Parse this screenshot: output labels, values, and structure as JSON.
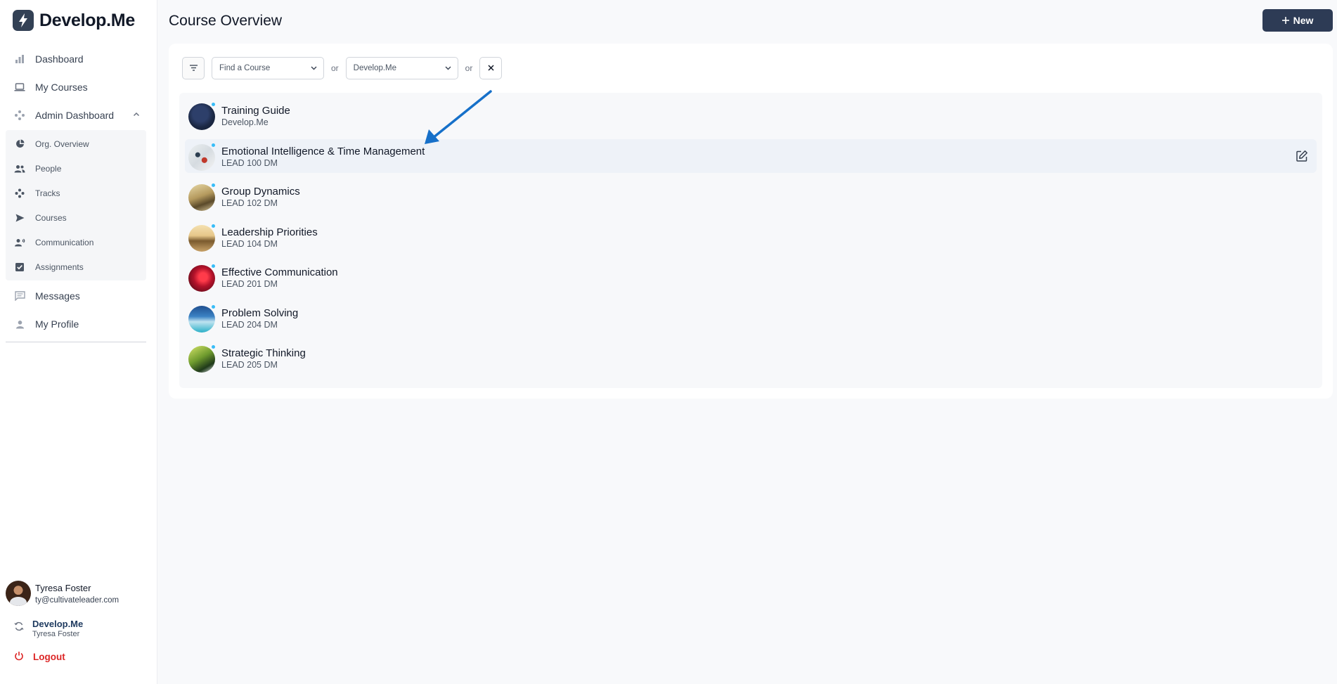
{
  "brand": {
    "name": "Develop.Me"
  },
  "sidebar": {
    "nav": [
      {
        "label": "Dashboard",
        "icon": "bar-chart-icon"
      },
      {
        "label": "My Courses",
        "icon": "laptop-icon"
      },
      {
        "label": "Admin Dashboard",
        "icon": "settings-cluster-icon",
        "expanded": true
      }
    ],
    "admin_items": [
      {
        "label": "Org. Overview",
        "icon": "pie-chart-icon"
      },
      {
        "label": "People",
        "icon": "people-icon"
      },
      {
        "label": "Tracks",
        "icon": "tracks-icon"
      },
      {
        "label": "Courses",
        "icon": "send-icon"
      },
      {
        "label": "Communication",
        "icon": "person-voice-icon"
      },
      {
        "label": "Assignments",
        "icon": "checkbox-icon"
      }
    ],
    "bottom_nav": [
      {
        "label": "Messages",
        "icon": "message-icon"
      },
      {
        "label": "My Profile",
        "icon": "person-icon"
      }
    ],
    "user": {
      "name": "Tyresa Foster",
      "email": "ty@cultivateleader.com"
    },
    "org": {
      "name": "Develop.Me",
      "user": "Tyresa Foster"
    },
    "logout_label": "Logout"
  },
  "header": {
    "title": "Course Overview",
    "new_label": "New"
  },
  "filters": {
    "course_select": "Find a Course",
    "or_1": "or",
    "org_select": "Develop.Me",
    "or_2": "or"
  },
  "courses": [
    {
      "title": "Training Guide",
      "code": "Develop.Me"
    },
    {
      "title": "Emotional Intelligence & Time Management",
      "code": "LEAD 100 DM"
    },
    {
      "title": "Group Dynamics",
      "code": "LEAD 102 DM"
    },
    {
      "title": "Leadership Priorities",
      "code": "LEAD 104 DM"
    },
    {
      "title": "Effective Communication",
      "code": "LEAD 201 DM"
    },
    {
      "title": "Problem Solving",
      "code": "LEAD 204 DM"
    },
    {
      "title": "Strategic Thinking",
      "code": "LEAD 205 DM"
    }
  ],
  "colors": {
    "accent": "#2d3b55",
    "row_highlight": "#eef2f8",
    "logout": "#dc2626",
    "annotation_arrow": "#1670c9"
  }
}
